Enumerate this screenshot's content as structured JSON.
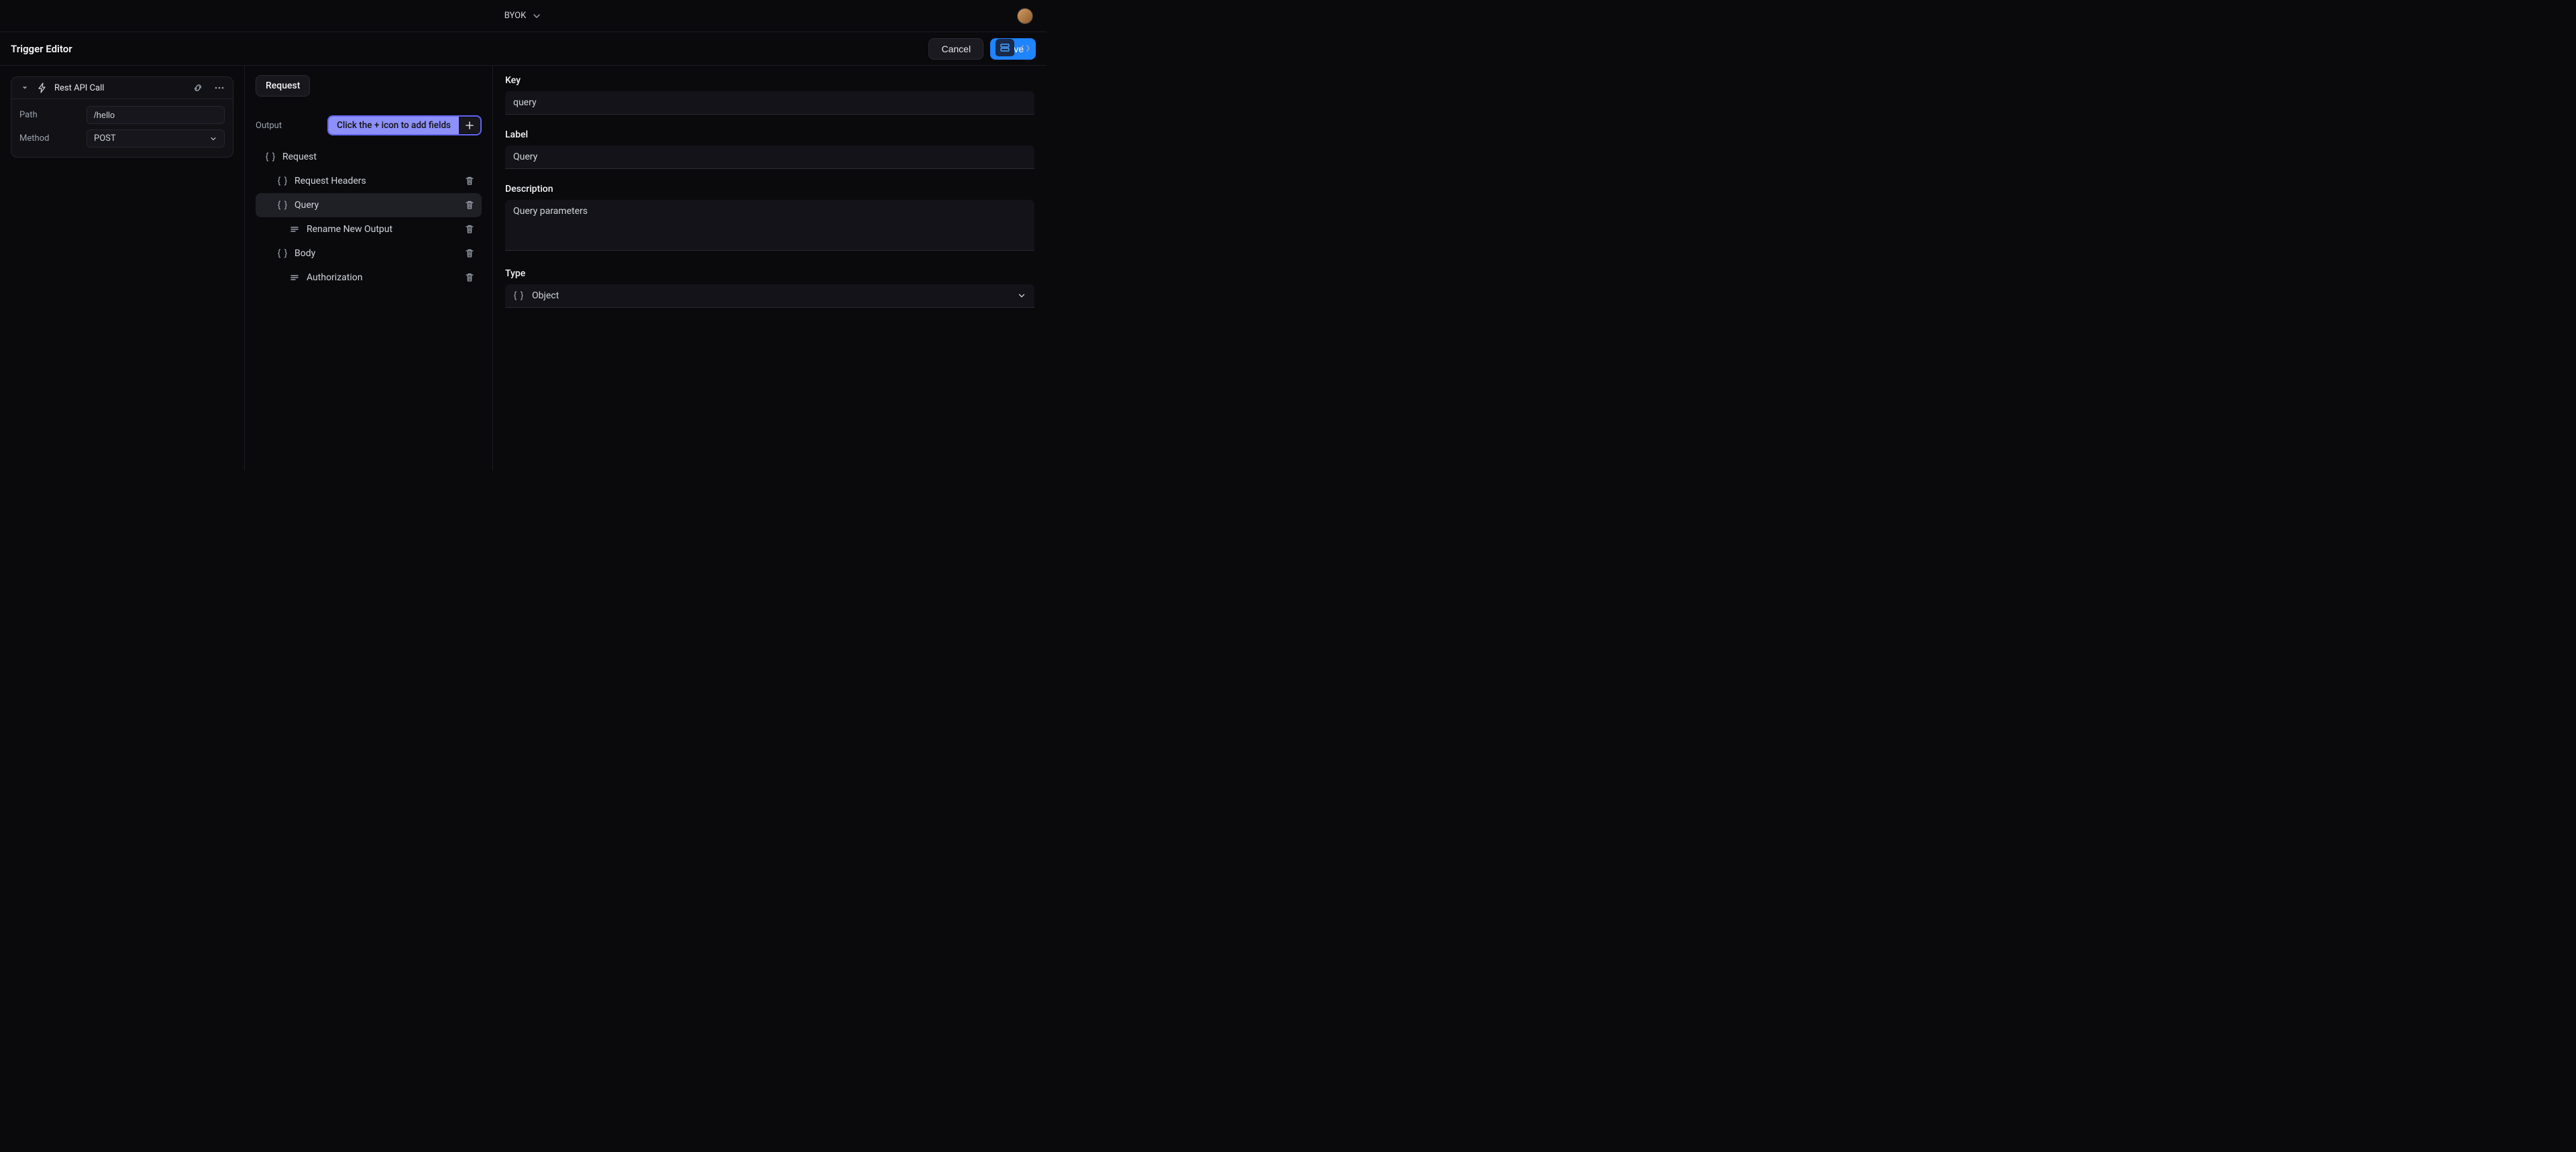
{
  "workspace": {
    "name": "BYOK"
  },
  "header": {
    "title": "Trigger Editor",
    "cancel": "Cancel",
    "save": "Save"
  },
  "sidebar": {
    "node": {
      "title": "Rest API Call",
      "path_label": "Path",
      "path_value": "/hello",
      "method_label": "Method",
      "method_value": "POST"
    }
  },
  "mid": {
    "tab": "Request",
    "output_label": "Output",
    "hint": "Click the + icon to add fields",
    "tree": {
      "request": "Request",
      "request_headers": "Request Headers",
      "query": "Query",
      "rename_new_output": "Rename New Output",
      "body": "Body",
      "authorization": "Authorization"
    }
  },
  "detail": {
    "key_label": "Key",
    "key_value": "query",
    "label_label": "Label",
    "label_value": "Query",
    "description_label": "Description",
    "description_value": "Query parameters",
    "type_label": "Type",
    "type_value": "Object"
  }
}
